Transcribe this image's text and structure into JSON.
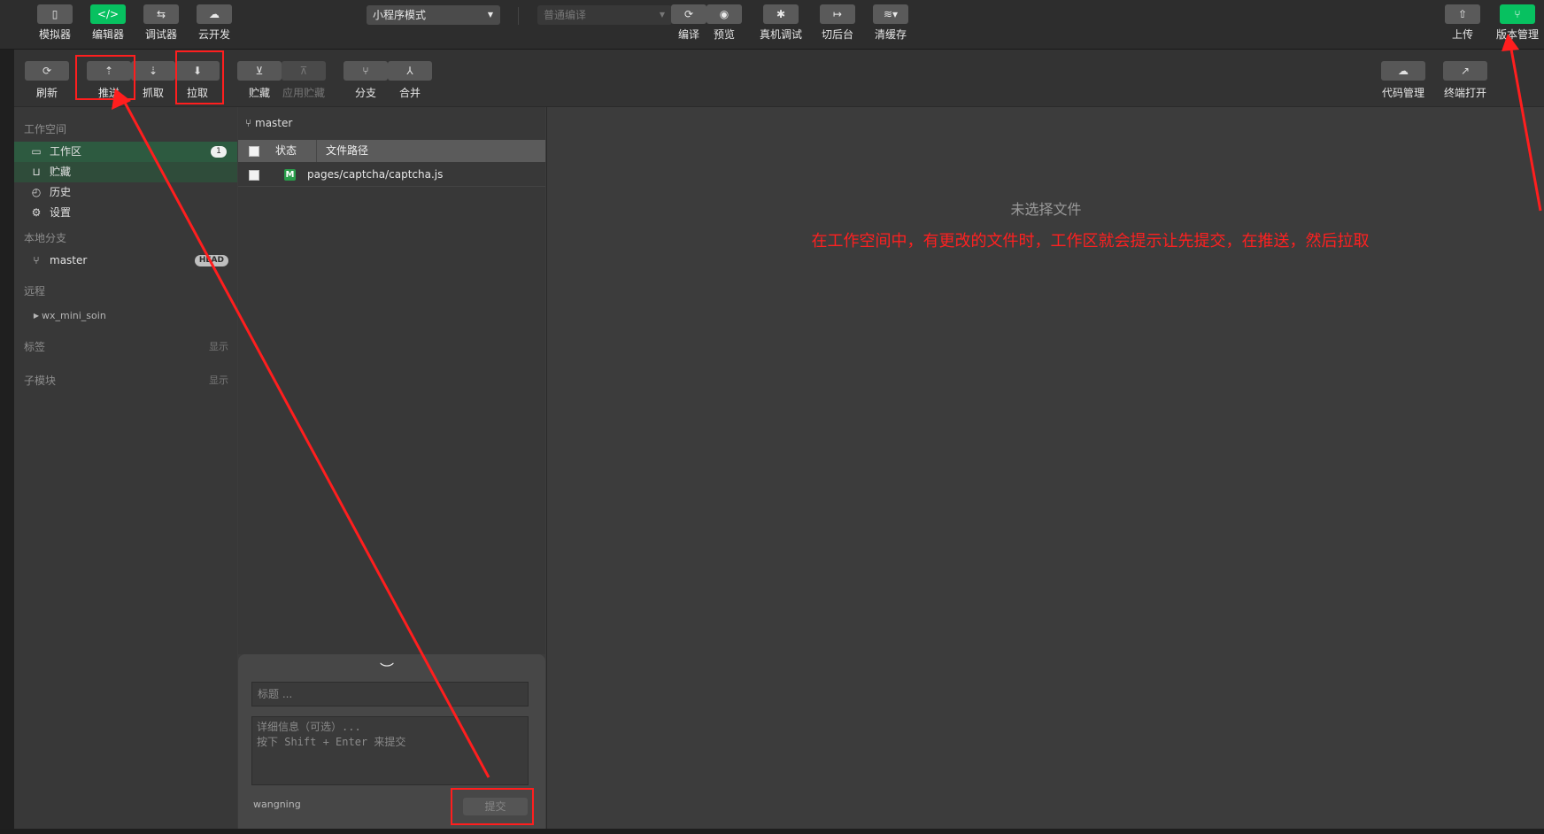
{
  "toolbar": {
    "simulator": "模拟器",
    "editor": "编辑器",
    "debugger": "调试器",
    "cloud": "云开发",
    "mode_select": "小程序模式",
    "compile_select": "普通编译",
    "compile": "编译",
    "preview": "预览",
    "real_debug": "真机调试",
    "background": "切后台",
    "clear_cache": "清缓存",
    "upload": "上传",
    "version_mgmt": "版本管理"
  },
  "git_toolbar": {
    "refresh": "刷新",
    "push": "推送",
    "fetch": "抓取",
    "pull": "拉取",
    "stash": "贮藏",
    "apply_stash": "应用贮藏",
    "branch": "分支",
    "merge": "合并",
    "code_mgmt": "代码管理",
    "terminal_open": "终端打开"
  },
  "sidebar": {
    "workspace_title": "工作空间",
    "items": [
      {
        "label": "工作区",
        "badge": "1"
      },
      {
        "label": "贮藏"
      },
      {
        "label": "历史"
      },
      {
        "label": "设置"
      }
    ],
    "local_branch_title": "本地分支",
    "branch": {
      "name": "master",
      "badge": "HEAD"
    },
    "remote_title": "远程",
    "remote": {
      "name": "wx_mini_soin"
    },
    "tags_title": "标签",
    "tags_show": "显示",
    "submodules_title": "子模块",
    "submodules_show": "显示"
  },
  "file_list": {
    "branch": "master",
    "col_status": "状态",
    "col_path": "文件路径",
    "files": [
      {
        "status": "M",
        "path": "pages/captcha/captcha.js"
      }
    ]
  },
  "commit": {
    "title_placeholder": "标题 ...",
    "detail_placeholder": "详细信息（可选）...\n按下 Shift + Enter 来提交",
    "author": "wangning",
    "submit": "提交"
  },
  "diff": {
    "no_file": "未选择文件",
    "annotation": "在工作空间中，有更改的文件时，工作区就会提示让先提交，在推送，然后拉取"
  },
  "colors": {
    "accent_green": "#07c160",
    "annotation_red": "#ff1e1e"
  }
}
